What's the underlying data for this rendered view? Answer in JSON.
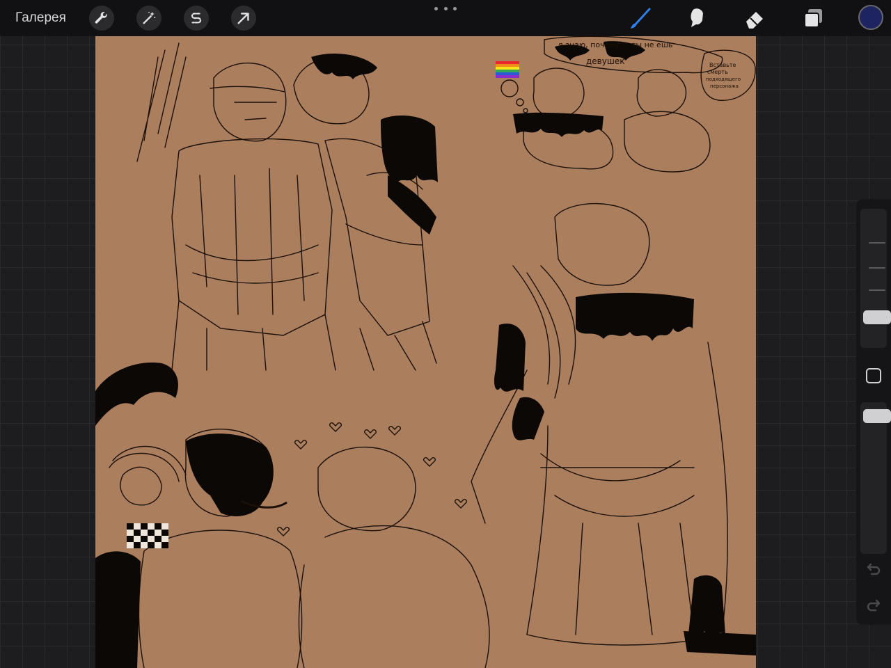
{
  "topbar": {
    "gallery_label": "Галерея",
    "left_tools": [
      {
        "name": "actions",
        "icon": "wrench-icon"
      },
      {
        "name": "adjustments",
        "icon": "magic-wand-icon"
      },
      {
        "name": "selection",
        "icon": "selection-s-icon"
      },
      {
        "name": "transform",
        "icon": "arrow-cursor-icon"
      }
    ],
    "more_icon": "more-dots-icon",
    "right_tools": [
      {
        "name": "brush",
        "icon": "brush-icon",
        "active": true
      },
      {
        "name": "smudge",
        "icon": "smudge-finger-icon",
        "active": false
      },
      {
        "name": "eraser",
        "icon": "eraser-icon",
        "active": false
      },
      {
        "name": "layers",
        "icon": "layers-icon",
        "active": false
      }
    ],
    "current_color": "#1d2460",
    "active_color": "#2f7fe8"
  },
  "canvas": {
    "background": "#ab7e5e",
    "annotations": {
      "speech_line1": "я знаю, почему",
      "speech_line2": "ты не ешь",
      "speech_line3": "девушек",
      "side_note_line1": "Вставьте",
      "side_note_line2": "смерть",
      "side_note_line3": "подходящего",
      "side_note_line4": "персонажа"
    }
  },
  "sidebar": {
    "brush_size_level": 0.15,
    "opacity_level": 0.05,
    "undo_icon": "undo-icon",
    "redo_icon": "redo-icon",
    "modify_icon": "square-modify-icon"
  }
}
